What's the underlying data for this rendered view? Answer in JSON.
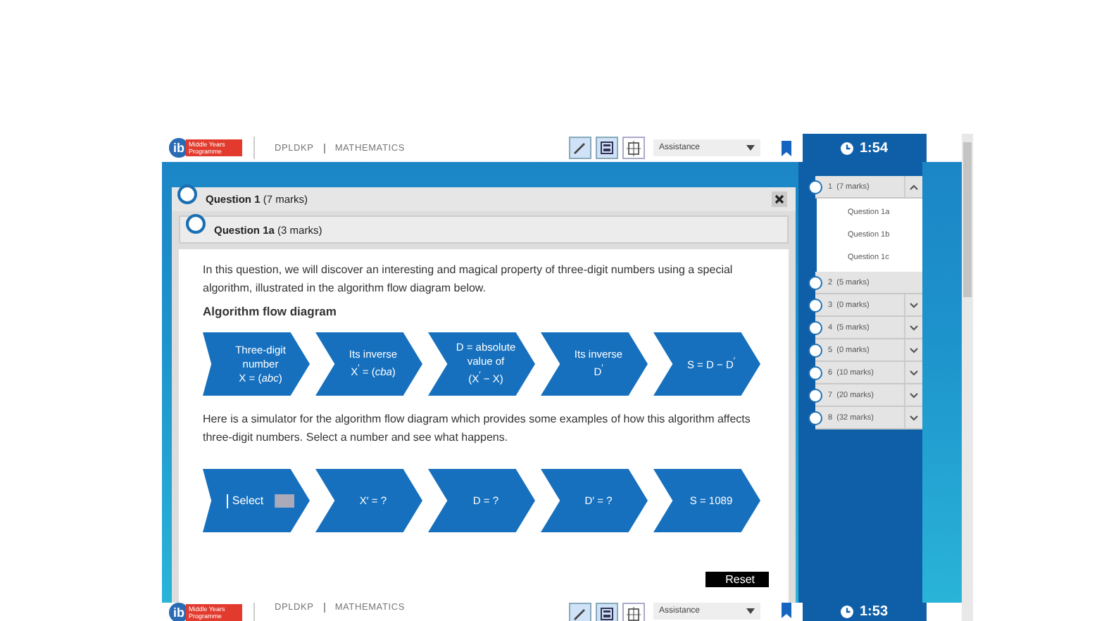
{
  "header": {
    "logo_text": "Middle Years Programme",
    "logo_mark": "ib",
    "course": "DPLDKP",
    "subject": "MATHEMATICS",
    "assistance": "Assistance",
    "timer": "1:54"
  },
  "question": {
    "title": "**Question 1** (7 marks)",
    "part_title": "**Question 1a** (3 marks)",
    "intro": "In this question, we will discover an interesting and magical property of three-digit numbers using a special algorithm, illustrated in the algorithm flow diagram below.",
    "diagram_heading": "Algorithm flow diagram",
    "flow": [
      {
        "lines": [
          "Three-digit",
          "number",
          "X = (*abc*)"
        ]
      },
      {
        "lines": [
          "Its inverse",
          "X$^{′}$ = (*cba*)"
        ]
      },
      {
        "lines": [
          "D = absolute",
          "value of",
          "(X$^{′}$ − X)"
        ]
      },
      {
        "lines": [
          "Its inverse",
          "D$^{′}$"
        ]
      },
      {
        "lines": [
          "S = D − D$^{′}$"
        ]
      }
    ],
    "simulator_text": "Here is a simulator for the algorithm flow diagram which provides some examples of how this algorithm affects three-digit numbers. Select a number and see what happens.",
    "simulator": [
      {
        "kind": "select",
        "text": "Select"
      },
      {
        "kind": "result",
        "text": "X′ = ?"
      },
      {
        "kind": "result",
        "text": "D = ?"
      },
      {
        "kind": "result",
        "text": "D′ = ?"
      },
      {
        "kind": "result",
        "text": "S = 1089"
      }
    ],
    "reset": "Reset"
  },
  "navigator": [
    {
      "number": "1",
      "marks": "(7 marks)",
      "kind": "group",
      "expanded": true,
      "children": [
        {
          "label": "Question 1a"
        },
        {
          "label": "Question 1b"
        },
        {
          "label": "Question 1c"
        }
      ]
    },
    {
      "number": "2",
      "marks": "(5 marks)",
      "kind": "single"
    },
    {
      "number": "3",
      "marks": "(0 marks)",
      "kind": "group",
      "expanded": false
    },
    {
      "number": "4",
      "marks": "(5 marks)",
      "kind": "group",
      "expanded": false
    },
    {
      "number": "5",
      "marks": "(0 marks)",
      "kind": "group",
      "expanded": false
    },
    {
      "number": "6",
      "marks": "(10 marks)",
      "kind": "group",
      "expanded": false
    },
    {
      "number": "7",
      "marks": "(20 marks)",
      "kind": "group",
      "expanded": false
    },
    {
      "number": "8",
      "marks": "(32 marks)",
      "kind": "group",
      "expanded": false
    }
  ],
  "next_header": {
    "logo_text": "Middle Years Programme",
    "logo_mark": "ib",
    "course": "DPLDKP",
    "subject": "MATHEMATICS",
    "assistance": "Assistance",
    "timer": "1:53"
  }
}
